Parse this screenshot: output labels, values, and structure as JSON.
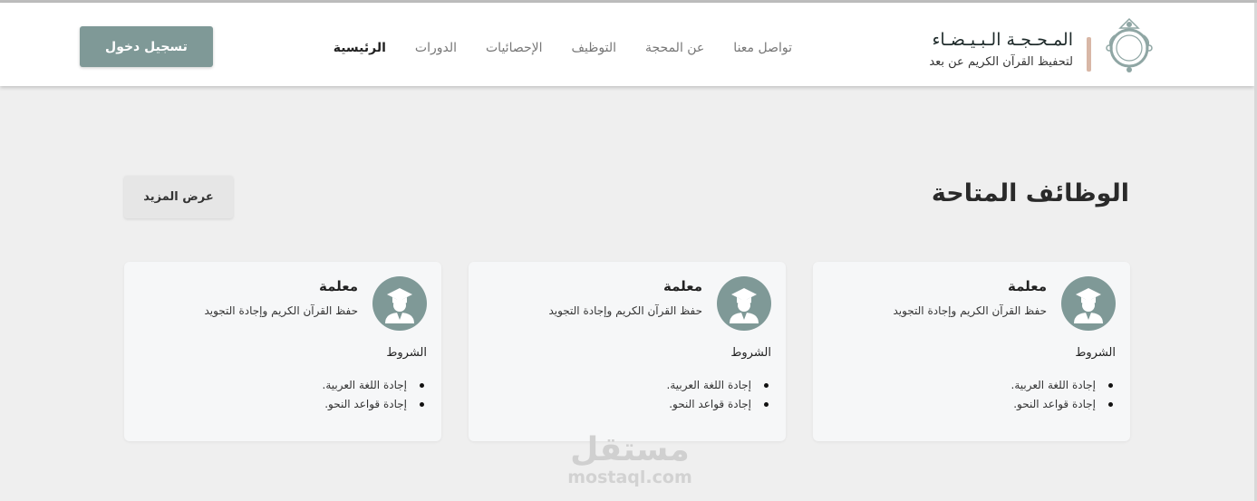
{
  "brand": {
    "name": "المـحـجـة الـبـيـضـاء",
    "tagline": "لتحفيظ القرآن الكريم عن بعد",
    "logo_icon": "ornate-ring-logo-icon",
    "accent_color": "#d8b7a6"
  },
  "nav": {
    "items": [
      {
        "label": "الرئيسية",
        "active": true
      },
      {
        "label": "الدورات",
        "active": false
      },
      {
        "label": "الإحصائيات",
        "active": false
      },
      {
        "label": "التوظيف",
        "active": false
      },
      {
        "label": "عن المحجة",
        "active": false
      },
      {
        "label": "تواصل معنا",
        "active": false
      }
    ]
  },
  "header": {
    "login_label": "تسجيل دخول",
    "login_color": "#7f9997"
  },
  "jobs": {
    "title": "الوظائف المتاحة",
    "more_label": "عرض المزيد",
    "cards": [
      {
        "role": "معلمة",
        "description": "حفظ القرآن الكريم وإجادة التجويد",
        "conditions_label": "الشروط",
        "conditions": [
          "إجادة اللغة العربية.",
          "إجادة قواعد النحو."
        ],
        "icon": "graduate-avatar-icon"
      },
      {
        "role": "معلمة",
        "description": "حفظ القرآن الكريم وإجادة التجويد",
        "conditions_label": "الشروط",
        "conditions": [
          "إجادة اللغة العربية.",
          "إجادة قواعد النحو."
        ],
        "icon": "graduate-avatar-icon"
      },
      {
        "role": "معلمة",
        "description": "حفظ القرآن الكريم وإجادة التجويد",
        "conditions_label": "الشروط",
        "conditions": [
          "إجادة اللغة العربية.",
          "إجادة قواعد النحو."
        ],
        "icon": "graduate-avatar-icon"
      }
    ]
  },
  "watermark": {
    "arabic": "مستقل",
    "latin": "mostaql.com"
  }
}
